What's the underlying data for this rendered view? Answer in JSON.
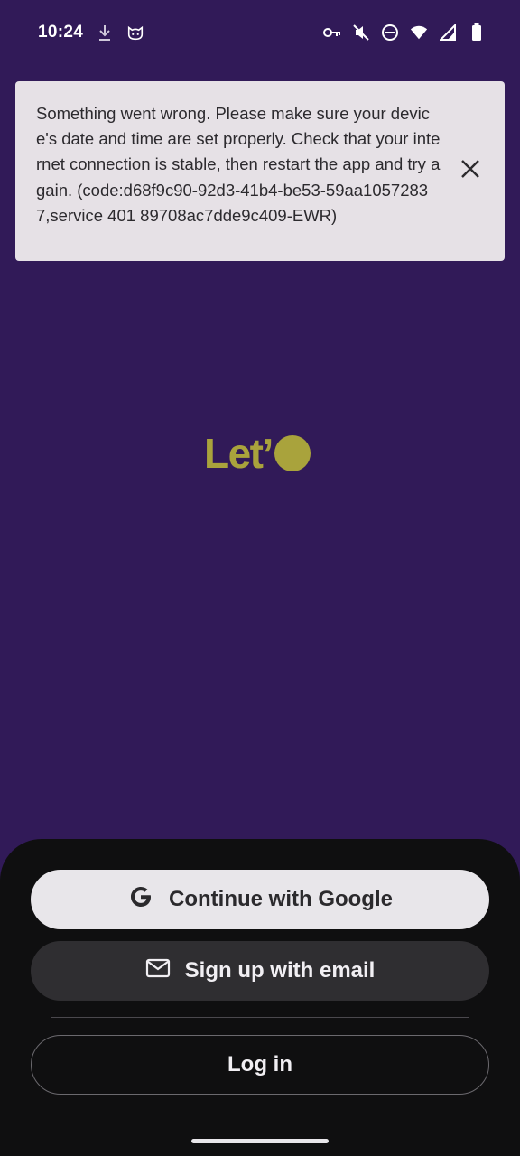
{
  "status_bar": {
    "time": "10:24",
    "icons": [
      "download-icon",
      "cat-icon",
      "key-icon",
      "vibrate-off-icon",
      "dnd-icon",
      "wifi-icon",
      "signal-icon",
      "battery-icon"
    ]
  },
  "error": {
    "message": "Something went wrong. Please make sure your device's date and time are set properly. Check that your internet connection is stable, then restart the app and try again. (code:d68f9c90-92d3-41b4-be53-59aa10572837,service 401 89708ac7dde9c409-EWR)",
    "close_icon": "close-icon"
  },
  "logo": {
    "text": "Let’"
  },
  "auth": {
    "google_label": "Continue with Google",
    "email_label": "Sign up with email",
    "login_label": "Log in"
  },
  "colors": {
    "background": "#311a58",
    "accent": "#a9a33c",
    "sheet": "#0f0f10"
  }
}
